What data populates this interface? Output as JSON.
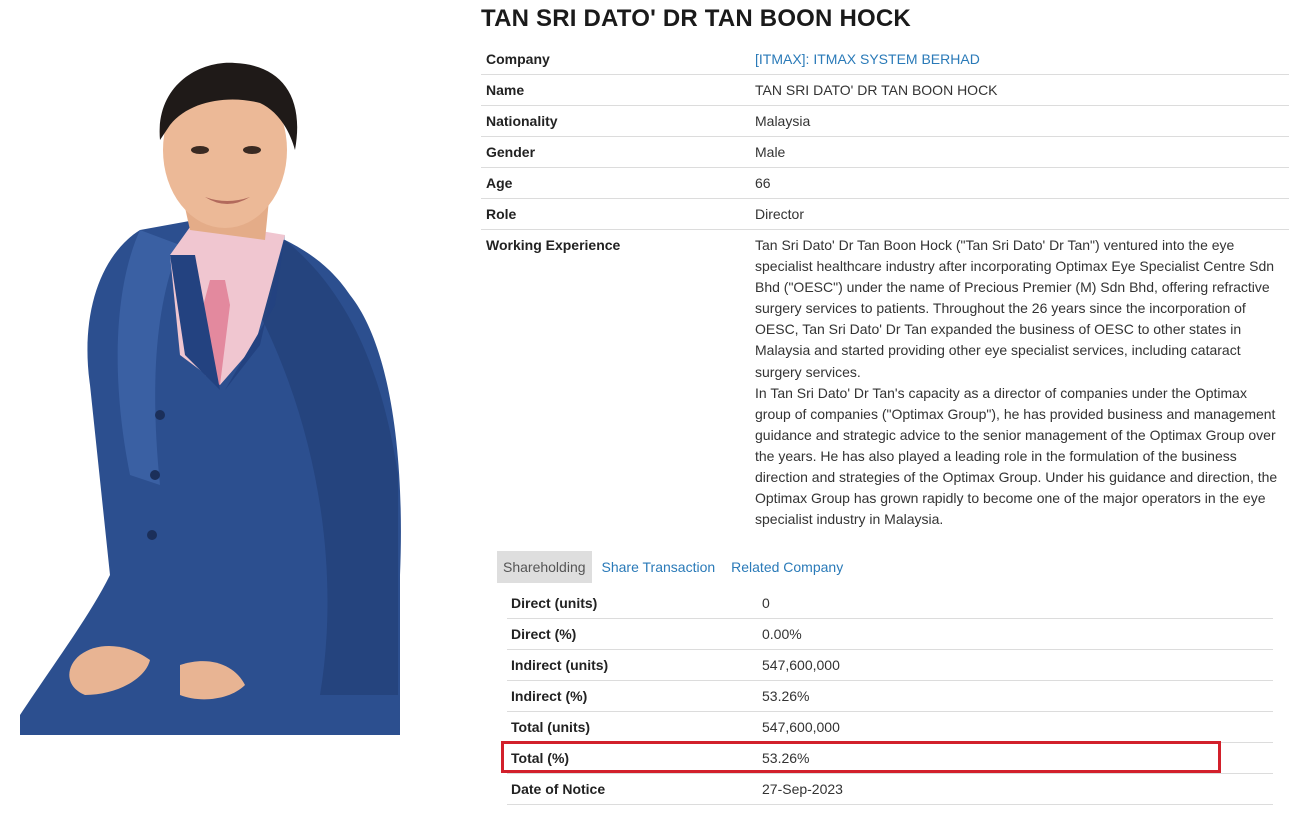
{
  "profile": {
    "title": "TAN SRI DATO' DR TAN BOON HOCK",
    "portrait_icon": "person-photo-icon"
  },
  "info": [
    {
      "label": "Company",
      "value": "[ITMAX]: ITMAX SYSTEM BERHAD",
      "is_link": true
    },
    {
      "label": "Name",
      "value": "TAN SRI DATO' DR TAN BOON HOCK"
    },
    {
      "label": "Nationality",
      "value": "Malaysia"
    },
    {
      "label": "Gender",
      "value": "Male"
    },
    {
      "label": "Age",
      "value": "66"
    },
    {
      "label": "Role",
      "value": "Director"
    },
    {
      "label": "Working Experience",
      "paragraphs": [
        "Tan Sri Dato' Dr Tan Boon Hock (\"Tan Sri Dato' Dr Tan\") ventured into the eye specialist healthcare industry after incorporating Optimax Eye Specialist Centre Sdn Bhd (\"OESC\") under the name of Precious Premier (M) Sdn Bhd, offering refractive surgery services to patients. Throughout the 26 years since the incorporation of OESC, Tan Sri Dato' Dr Tan expanded the business of OESC to other states in Malaysia and started providing other eye specialist services, including cataract surgery services.",
        "In Tan Sri Dato' Dr Tan's capacity as a director of companies under the Optimax group of companies (\"Optimax Group\"), he has provided business and management guidance and strategic advice to the senior management of the Optimax Group over the years. He has also played a leading role in the formulation of the business direction and strategies of the Optimax Group. Under his guidance and direction, the Optimax Group has grown rapidly to become one of the major operators in the eye specialist industry in Malaysia."
      ]
    }
  ],
  "tabs": {
    "shareholding": "Shareholding",
    "share_transaction": "Share Transaction",
    "related_company": "Related Company"
  },
  "shareholding": [
    {
      "label": "Direct (units)",
      "value": "0"
    },
    {
      "label": "Direct (%)",
      "value": "0.00%"
    },
    {
      "label": "Indirect (units)",
      "value": "547,600,000"
    },
    {
      "label": "Indirect (%)",
      "value": "53.26%"
    },
    {
      "label": "Total (units)",
      "value": "547,600,000"
    },
    {
      "label": "Total (%)",
      "value": "53.26%"
    },
    {
      "label": "Date of Notice",
      "value": "27-Sep-2023"
    }
  ],
  "colors": {
    "link": "#2a7ab8",
    "highlight": "#d2202b",
    "active_tab_bg": "#dedede"
  }
}
